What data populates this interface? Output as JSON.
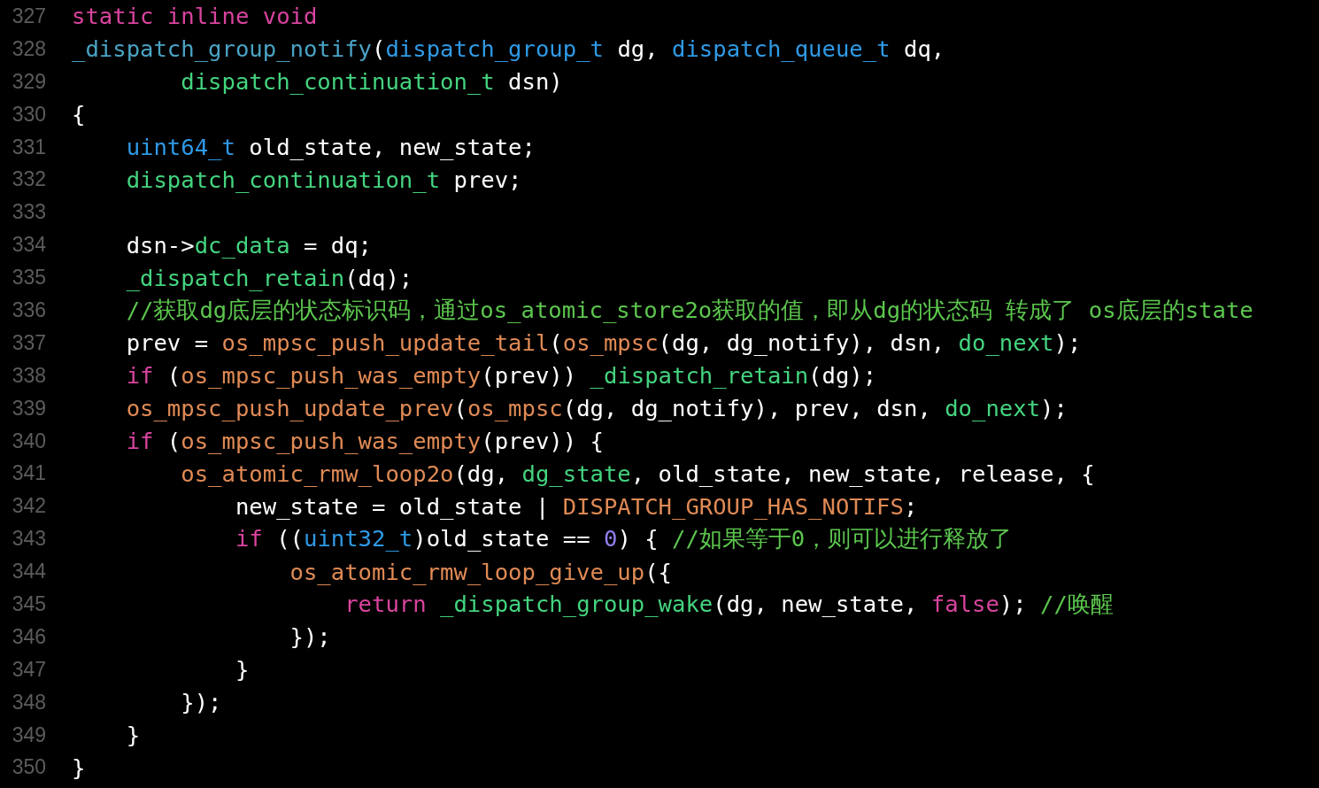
{
  "editor": {
    "lines": [
      {
        "number": "327",
        "tokens": [
          {
            "kind": "keyword",
            "text": "static inline void"
          }
        ]
      },
      {
        "number": "328",
        "tokens": [
          {
            "kind": "declaration",
            "text": "_dispatch_group_notify"
          },
          {
            "kind": "plain",
            "text": "("
          },
          {
            "kind": "type",
            "text": "dispatch_group_t"
          },
          {
            "kind": "plain",
            "text": " dg, "
          },
          {
            "kind": "type",
            "text": "dispatch_queue_t"
          },
          {
            "kind": "plain",
            "text": " dq,"
          }
        ]
      },
      {
        "number": "329",
        "tokens": [
          {
            "kind": "project",
            "text": "        dispatch_continuation_t"
          },
          {
            "kind": "plain",
            "text": " dsn)"
          }
        ]
      },
      {
        "number": "330",
        "tokens": [
          {
            "kind": "plain",
            "text": "{"
          }
        ]
      },
      {
        "number": "331",
        "tokens": [
          {
            "kind": "type",
            "text": "    uint64_t"
          },
          {
            "kind": "plain",
            "text": " old_state, new_state;"
          }
        ]
      },
      {
        "number": "332",
        "tokens": [
          {
            "kind": "project",
            "text": "    dispatch_continuation_t"
          },
          {
            "kind": "plain",
            "text": " prev;"
          }
        ]
      },
      {
        "number": "333"
      },
      {
        "number": "334",
        "tokens": [
          {
            "kind": "plain",
            "text": "    dsn->"
          },
          {
            "kind": "project",
            "text": "dc_data"
          },
          {
            "kind": "plain",
            "text": " = dq;"
          }
        ]
      },
      {
        "number": "335",
        "tokens": [
          {
            "kind": "project",
            "text": "    _dispatch_retain"
          },
          {
            "kind": "plain",
            "text": "(dq);"
          }
        ]
      },
      {
        "number": "336",
        "tokens": [
          {
            "kind": "comment",
            "text": "    //获取dg底层的状态标识码，通过os_atomic_store2o获取的值，即从dg的状态码 转成了 os底层的state"
          }
        ]
      },
      {
        "number": "337",
        "tokens": [
          {
            "kind": "plain",
            "text": "    prev = "
          },
          {
            "kind": "macro",
            "text": "os_mpsc_push_update_tail"
          },
          {
            "kind": "plain",
            "text": "("
          },
          {
            "kind": "macro",
            "text": "os_mpsc"
          },
          {
            "kind": "plain",
            "text": "(dg, dg_notify), dsn, "
          },
          {
            "kind": "project",
            "text": "do_next"
          },
          {
            "kind": "plain",
            "text": ");"
          }
        ]
      },
      {
        "number": "338",
        "tokens": [
          {
            "kind": "keyword",
            "text": "    if"
          },
          {
            "kind": "plain",
            "text": " ("
          },
          {
            "kind": "macro",
            "text": "os_mpsc_push_was_empty"
          },
          {
            "kind": "plain",
            "text": "(prev)) "
          },
          {
            "kind": "project",
            "text": "_dispatch_retain"
          },
          {
            "kind": "plain",
            "text": "(dg);"
          }
        ]
      },
      {
        "number": "339",
        "tokens": [
          {
            "kind": "macro",
            "text": "    os_mpsc_push_update_prev"
          },
          {
            "kind": "plain",
            "text": "("
          },
          {
            "kind": "macro",
            "text": "os_mpsc"
          },
          {
            "kind": "plain",
            "text": "(dg, dg_notify), prev, dsn, "
          },
          {
            "kind": "project",
            "text": "do_next"
          },
          {
            "kind": "plain",
            "text": ");"
          }
        ]
      },
      {
        "number": "340",
        "tokens": [
          {
            "kind": "keyword",
            "text": "    if"
          },
          {
            "kind": "plain",
            "text": " ("
          },
          {
            "kind": "macro",
            "text": "os_mpsc_push_was_empty"
          },
          {
            "kind": "plain",
            "text": "(prev)) {"
          }
        ]
      },
      {
        "number": "341",
        "tokens": [
          {
            "kind": "macro",
            "text": "        os_atomic_rmw_loop2o"
          },
          {
            "kind": "plain",
            "text": "(dg, "
          },
          {
            "kind": "project",
            "text": "dg_state"
          },
          {
            "kind": "plain",
            "text": ", old_state, new_state, release, {"
          }
        ]
      },
      {
        "number": "342",
        "tokens": [
          {
            "kind": "plain",
            "text": "            new_state = old_state | "
          },
          {
            "kind": "macro",
            "text": "DISPATCH_GROUP_HAS_NOTIFS"
          },
          {
            "kind": "plain",
            "text": ";"
          }
        ]
      },
      {
        "number": "343",
        "tokens": [
          {
            "kind": "keyword",
            "text": "            if"
          },
          {
            "kind": "plain",
            "text": " (("
          },
          {
            "kind": "type",
            "text": "uint32_t"
          },
          {
            "kind": "plain",
            "text": ")old_state == "
          },
          {
            "kind": "number",
            "text": "0"
          },
          {
            "kind": "plain",
            "text": ") { "
          },
          {
            "kind": "comment",
            "text": "//如果等于0，则可以进行释放了"
          }
        ]
      },
      {
        "number": "344",
        "tokens": [
          {
            "kind": "macro",
            "text": "                os_atomic_rmw_loop_give_up"
          },
          {
            "kind": "plain",
            "text": "({"
          }
        ]
      },
      {
        "number": "345",
        "tokens": [
          {
            "kind": "keyword",
            "text": "                    return"
          },
          {
            "kind": "project",
            "text": " _dispatch_group_wake"
          },
          {
            "kind": "plain",
            "text": "(dg, new_state, "
          },
          {
            "kind": "keyword",
            "text": "false"
          },
          {
            "kind": "plain",
            "text": "); "
          },
          {
            "kind": "comment",
            "text": "//唤醒"
          }
        ]
      },
      {
        "number": "346",
        "tokens": [
          {
            "kind": "plain",
            "text": "                });"
          }
        ]
      },
      {
        "number": "347",
        "tokens": [
          {
            "kind": "plain",
            "text": "            }"
          }
        ]
      },
      {
        "number": "348",
        "tokens": [
          {
            "kind": "plain",
            "text": "        });"
          }
        ]
      },
      {
        "number": "349",
        "tokens": [
          {
            "kind": "plain",
            "text": "    }"
          }
        ]
      },
      {
        "number": "350",
        "tokens": [
          {
            "kind": "plain",
            "text": "}"
          }
        ]
      }
    ]
  }
}
